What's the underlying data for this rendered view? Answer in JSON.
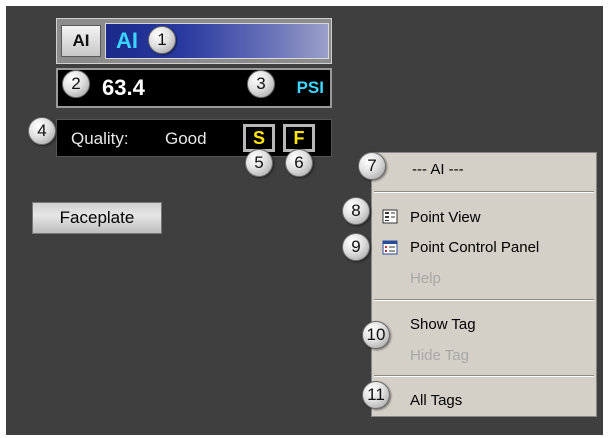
{
  "faceplate_widget": {
    "tag_button_label": "AI",
    "tag_name": "AI",
    "value": "63.4",
    "units": "PSI",
    "quality_label": "Quality:",
    "quality_value": "Good",
    "s_button_label": "S",
    "f_button_label": "F"
  },
  "faceplate_button": {
    "label": "Faceplate"
  },
  "context_menu": {
    "header": "--- AI ---",
    "items": [
      {
        "label": "Point View",
        "icon": "point-view-icon",
        "enabled": true
      },
      {
        "label": "Point Control Panel",
        "icon": "control-panel-icon",
        "enabled": true
      },
      {
        "label": "Help",
        "enabled": false
      },
      {
        "label": "Show Tag",
        "enabled": true
      },
      {
        "label": "Hide Tag",
        "enabled": false
      },
      {
        "label": "All Tags",
        "enabled": true
      }
    ]
  },
  "callouts": [
    "1",
    "2",
    "3",
    "4",
    "5",
    "6",
    "7",
    "8",
    "9",
    "10",
    "11"
  ],
  "colors": {
    "background": "#3f3f3f",
    "tag_text": "#3ad6ff",
    "sf_text": "#ffe400",
    "menu_bg": "#d4d0c8"
  }
}
